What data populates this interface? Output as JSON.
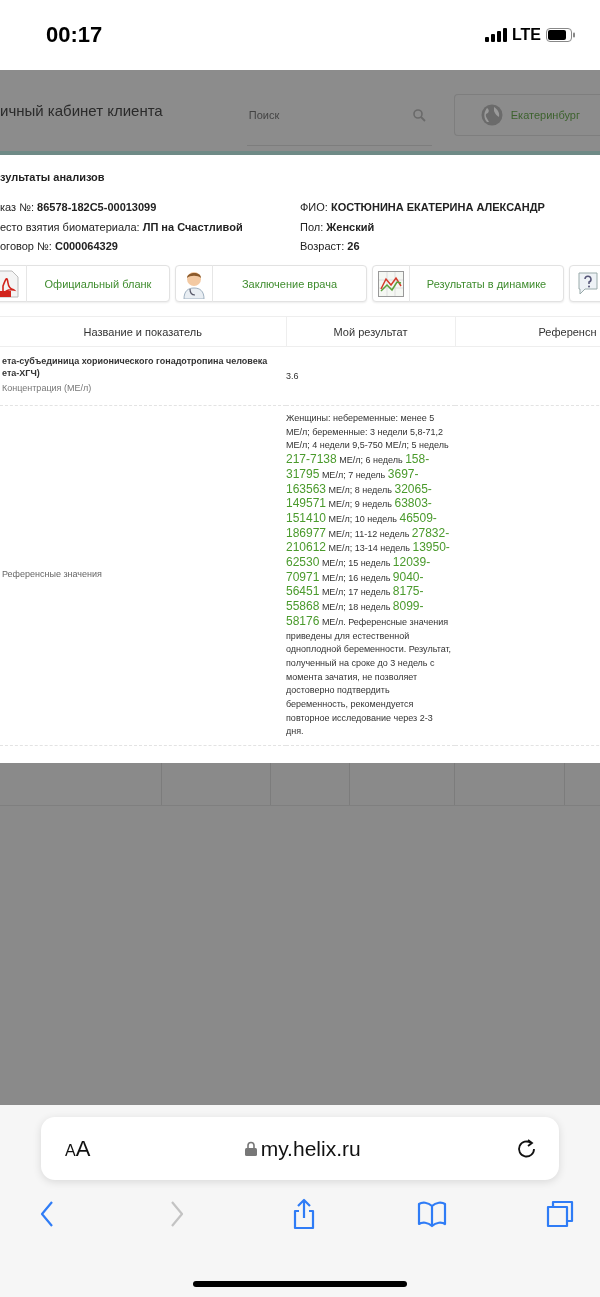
{
  "status_bar": {
    "time": "00:17",
    "network": "LTE"
  },
  "site_header": {
    "title": "ичный кабинет клиента",
    "search": {
      "placeholder": "Поиск"
    },
    "city": "Екатеринбург"
  },
  "modal": {
    "title": "зультаты анализов",
    "info_left": [
      {
        "label": "каз №:",
        "value": "86578-182С5-00013099"
      },
      {
        "label": "есто взятия биоматериала:",
        "value": "ЛП на Счастливой"
      },
      {
        "label": "оговор №:",
        "value": "С000064329"
      }
    ],
    "info_right": [
      {
        "label": "ФИО:",
        "value": "КОСТЮНИНА ЕКАТЕРИНА АЛЕКСАНДР"
      },
      {
        "label": "Пол:",
        "value": "Женский"
      },
      {
        "label": "Возраст:",
        "value": "26"
      }
    ],
    "actions": [
      {
        "kind": "pdf",
        "label": "Официальный бланк"
      },
      {
        "kind": "doctor",
        "label": "Заключение врача"
      },
      {
        "kind": "chart",
        "label": "Результаты в динамике"
      },
      {
        "kind": "help"
      }
    ],
    "table": {
      "columns": [
        "Название и показатель",
        "Мой результат",
        "Референсн"
      ],
      "rows": [
        {
          "kind": "test",
          "name_lines": [
            "ета-субъединица хорионического гонадотропина человека",
            "ета-ХГЧ)"
          ],
          "unit": "Концентрация (МЕ/л)",
          "result": "3.6"
        },
        {
          "kind": "reference",
          "label": "Референсные значения",
          "segments": [
            {
              "kind": "text",
              "text": "Женщины: небеременные: менее 5 МЕ/л; беременные: 3 недели 5,8-71,2 МЕ/л; 4 недели 9,5-750 МЕ/л; 5 недель "
            },
            {
              "kind": "range",
              "text": "217-7138"
            },
            {
              "kind": "text",
              "text": " МЕ/л; 6 недель "
            },
            {
              "kind": "range",
              "text": "158-31795"
            },
            {
              "kind": "text",
              "text": " МЕ/л; 7 недель "
            },
            {
              "kind": "range",
              "text": "3697-163563"
            },
            {
              "kind": "text",
              "text": " МЕ/л; 8 недель "
            },
            {
              "kind": "range",
              "text": "32065-149571"
            },
            {
              "kind": "text",
              "text": " МЕ/л; 9 недель "
            },
            {
              "kind": "range",
              "text": "63803-151410"
            },
            {
              "kind": "text",
              "text": " МЕ/л; 10 недель "
            },
            {
              "kind": "range",
              "text": "46509-186977"
            },
            {
              "kind": "text",
              "text": " МЕ/л; 11-12 недель "
            },
            {
              "kind": "range",
              "text": "27832-210612"
            },
            {
              "kind": "text",
              "text": " МЕ/л; 13-14 недель "
            },
            {
              "kind": "range",
              "text": "13950-62530"
            },
            {
              "kind": "text",
              "text": " МЕ/л; 15 недель "
            },
            {
              "kind": "range",
              "text": "12039-70971"
            },
            {
              "kind": "text",
              "text": " МЕ/л; 16 недель "
            },
            {
              "kind": "range",
              "text": "9040-56451"
            },
            {
              "kind": "text",
              "text": " МЕ/л; 17 недель "
            },
            {
              "kind": "range",
              "text": "8175-55868"
            },
            {
              "kind": "text",
              "text": " МЕ/л; 18 недель "
            },
            {
              "kind": "range",
              "text": "8099-58176"
            },
            {
              "kind": "text",
              "text": " МЕ/л. Референсные значения приведены для естественной одноплодной беременности. Результат, полученный на сроке до 3 недель с момента зачатия, не позволяет достоверно подтвердить беременность, рекомендуется повторное исследование через 2-3 дня."
            }
          ]
        }
      ]
    }
  },
  "browser": {
    "text_size": "AA",
    "url": "my.helix.ru",
    "toolbar": [
      {
        "kind": "back",
        "disabled": false
      },
      {
        "kind": "forward",
        "disabled": true
      },
      {
        "kind": "share",
        "disabled": false
      },
      {
        "kind": "bookmarks",
        "disabled": false
      },
      {
        "kind": "tabs",
        "disabled": false
      }
    ]
  }
}
